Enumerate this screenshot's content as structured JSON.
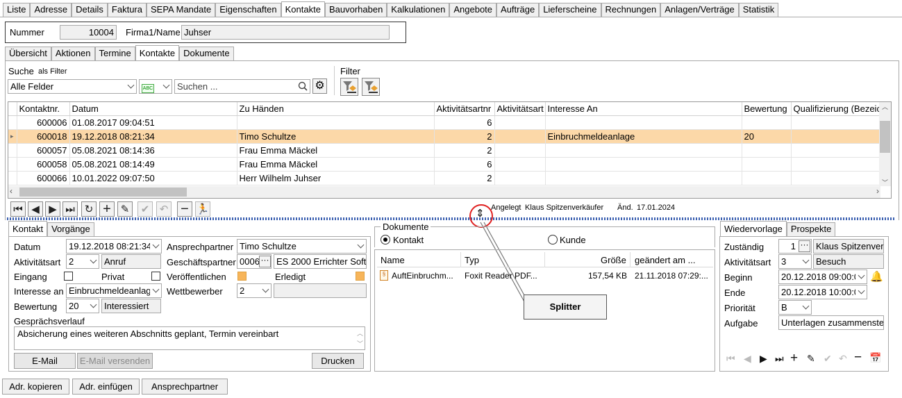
{
  "top_tabs": [
    "Liste",
    "Adresse",
    "Details",
    "Faktura",
    "SEPA Mandate",
    "Eigenschaften",
    "Kontakte",
    "Bauvorhaben",
    "Kalkulationen",
    "Angebote",
    "Aufträge",
    "Lieferscheine",
    "Rechnungen",
    "Anlagen/Verträge",
    "Statistik"
  ],
  "header": {
    "nummer_label": "Nummer",
    "nummer": "10004",
    "firma_label": "Firma1/Name",
    "firma": "Juhser"
  },
  "sub_tabs": [
    "Übersicht",
    "Aktionen",
    "Termine",
    "Kontakte",
    "Dokumente"
  ],
  "search": {
    "label": "Suche",
    "filter_hint": "als Filter",
    "field": "Alle Felder",
    "placeholder": "Suchen ...",
    "filter_label": "Filter"
  },
  "grid": {
    "columns": [
      "Kontaktnr.",
      "Datum",
      "Zu Händen",
      "Aktivitätsartnr",
      "Aktivitätsart",
      "Interesse An",
      "Bewertung",
      "Qualifizierung (Bezeic"
    ],
    "rows": [
      [
        "600006",
        "01.08.2017 09:04:51",
        "",
        "6",
        "",
        "",
        ""
      ],
      [
        "600018",
        "19.12.2018 08:21:34",
        "Timo Schultze",
        "2",
        "",
        "Einbruchmeldeanlage",
        "20"
      ],
      [
        "600057",
        "05.08.2021 08:14:36",
        "Frau Emma Mäckel",
        "2",
        "",
        "",
        ""
      ],
      [
        "600058",
        "05.08.2021 08:14:49",
        "Frau Emma Mäckel",
        "6",
        "",
        "",
        ""
      ],
      [
        "600066",
        "10.01.2022 09:07:50",
        "Herr Wilhelm Juhser",
        "2",
        "",
        "",
        ""
      ]
    ]
  },
  "status": {
    "angelegt_label": "Angelegt",
    "angelegt_by": "Klaus Spitzenverkäufer",
    "aend_label": "Änd.",
    "aend_date": "17.01.2024"
  },
  "detail_tabs": [
    "Kontakt",
    "Vorgänge"
  ],
  "detail": {
    "datum_label": "Datum",
    "datum": "19.12.2018 08:21:34",
    "aktart_label": "Aktivitätsart",
    "aktart_nr": "2",
    "aktart": "Anruf",
    "eingang_label": "Eingang",
    "privat_label": "Privat",
    "interesse_label": "Interesse an",
    "interesse": "Einbruchmeldeanlag",
    "bewertung_label": "Bewertung",
    "bewertung_nr": "20",
    "bewertung": "Interessiert",
    "ansprech_label": "Ansprechpartner",
    "ansprech": "Timo Schultze",
    "gp_label": "Geschäftspartner",
    "gp_nr": "0006",
    "gp_name": "ES 2000 Errichter Softw",
    "veroeff_label": "Veröffentlichen",
    "erledigt_label": "Erledigt",
    "wettb_label": "Wettbewerber",
    "wettb": "2",
    "verlauf_label": "Gesprächsverlauf",
    "verlauf": "Absicherung eines weiteren Abschnitts geplant, Termin vereinbart",
    "email_btn": "E-Mail",
    "email_send_btn": "E-Mail versenden",
    "print_btn": "Drucken"
  },
  "docs": {
    "title": "Dokumente",
    "radio_kontakt": "Kontakt",
    "radio_kunde": "Kunde",
    "columns": [
      "Name",
      "Typ",
      "Größe",
      "geändert am ..."
    ],
    "rows": [
      [
        "AuftEinbruchm...",
        "Foxit Reader PDF...",
        "157,54 KB",
        "21.11.2018 07:29:..."
      ]
    ]
  },
  "callout": "Splitter",
  "wv_tabs": [
    "Wiedervorlage",
    "Prospekte"
  ],
  "wv": {
    "zust_label": "Zuständig",
    "zust_nr": "1",
    "zust": "Klaus Spitzenver",
    "aktart_label": "Aktivitätsart",
    "aktart_nr": "3",
    "aktart": "Besuch",
    "beginn_label": "Beginn",
    "beginn": "20.12.2018 09:00:0",
    "ende_label": "Ende",
    "ende": "20.12.2018 10:00:0",
    "prio_label": "Priorität",
    "prio": "B",
    "aufgabe_label": "Aufgabe",
    "aufgabe": "Unterlagen zusammenste"
  },
  "bottom_buttons": [
    "Adr. kopieren",
    "Adr. einfügen",
    "Ansprechpartner"
  ],
  "colors": {
    "selected_row": "#fcd8a8",
    "checkbox_on": "#f7b55a",
    "callout_circle": "#e02020"
  }
}
